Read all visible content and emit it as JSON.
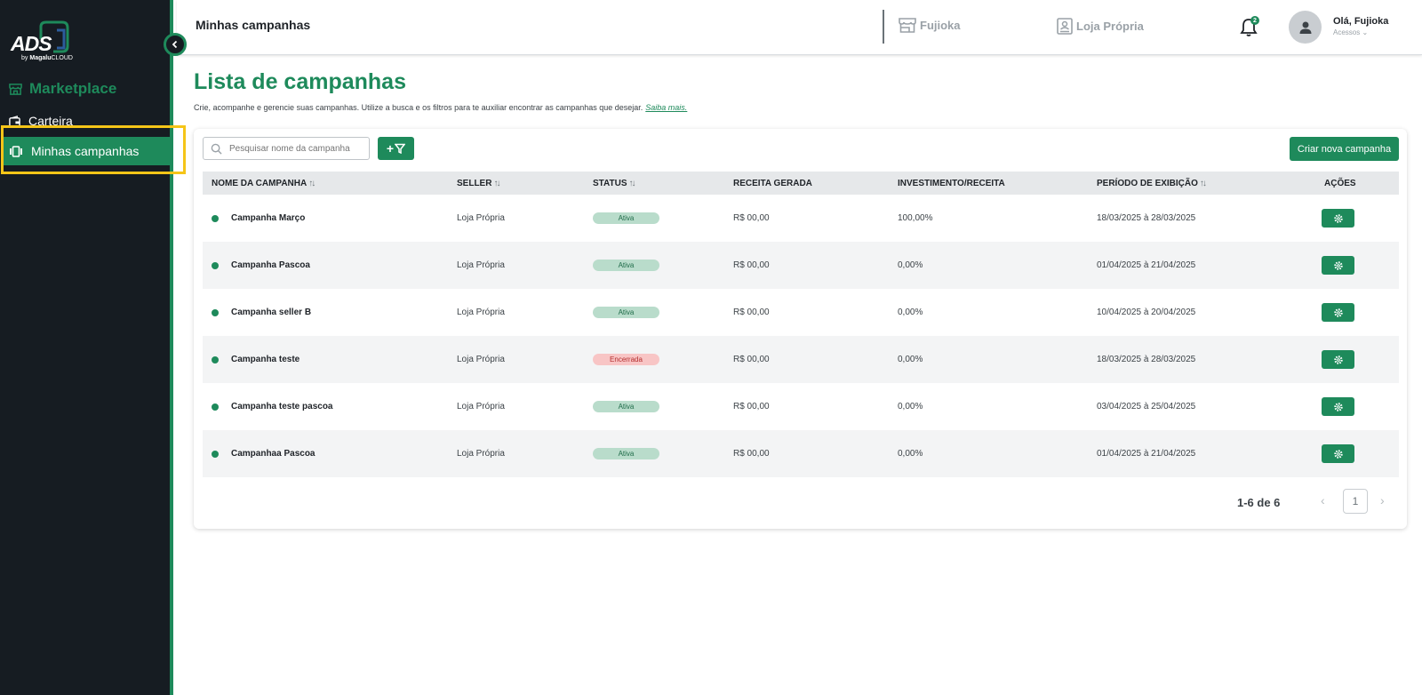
{
  "sidebar": {
    "logo": {
      "text": "ADS",
      "by": "by",
      "brand": "Magalu",
      "brand_suffix": "CLOUD"
    },
    "section_label": "Marketplace",
    "items": [
      {
        "label": "Carteira",
        "icon": "wallet-icon",
        "active": false
      },
      {
        "label": "Minhas campanhas",
        "icon": "campaigns-icon",
        "active": true
      }
    ]
  },
  "header": {
    "title": "Minhas campanhas",
    "stores": [
      {
        "label": "Fujioka",
        "icon": "store-icon"
      },
      {
        "label": "Loja Própria",
        "icon": "store-id-icon"
      }
    ],
    "notifications": {
      "count": "2"
    },
    "user": {
      "greeting": "Olá, Fujioka",
      "access_label": "Acessos"
    }
  },
  "page": {
    "title": "Lista de campanhas",
    "description": "Crie, acompanhe e gerencie suas campanhas. Utilize a busca e os filtros para te auxiliar encontrar as campanhas que desejar.",
    "learn_more": "Saiba mais."
  },
  "toolbar": {
    "search_placeholder": "Pesquisar nome da campanha",
    "filter_label": "+",
    "create_label": "Criar nova campanha"
  },
  "table": {
    "columns": [
      {
        "label": "NOME DA CAMPANHA",
        "sortable": true
      },
      {
        "label": "SELLER",
        "sortable": true
      },
      {
        "label": "STATUS",
        "sortable": true
      },
      {
        "label": "RECEITA GERADA",
        "sortable": false
      },
      {
        "label": "INVESTIMENTO/RECEITA",
        "sortable": false
      },
      {
        "label": "PERÍODO DE EXIBIÇÃO",
        "sortable": true
      },
      {
        "label": "AÇÕES",
        "sortable": false
      }
    ],
    "rows": [
      {
        "name": "Campanha Março",
        "seller": "Loja Própria",
        "status": "Ativa",
        "revenue": "R$ 00,00",
        "ratio": "100,00%",
        "period": "18/03/2025 à 28/03/2025"
      },
      {
        "name": "Campanha Pascoa",
        "seller": "Loja Própria",
        "status": "Ativa",
        "revenue": "R$ 00,00",
        "ratio": "0,00%",
        "period": "01/04/2025 à 21/04/2025"
      },
      {
        "name": "Campanha seller B",
        "seller": "Loja Própria",
        "status": "Ativa",
        "revenue": "R$ 00,00",
        "ratio": "0,00%",
        "period": "10/04/2025 à 20/04/2025"
      },
      {
        "name": "Campanha teste",
        "seller": "Loja Própria",
        "status": "Encerrada",
        "revenue": "R$ 00,00",
        "ratio": "0,00%",
        "period": "18/03/2025 à 28/03/2025"
      },
      {
        "name": "Campanha teste pascoa",
        "seller": "Loja Própria",
        "status": "Ativa",
        "revenue": "R$ 00,00",
        "ratio": "0,00%",
        "period": "03/04/2025 à 25/04/2025"
      },
      {
        "name": "Campanhaa Pascoa",
        "seller": "Loja Própria",
        "status": "Ativa",
        "revenue": "R$ 00,00",
        "ratio": "0,00%",
        "period": "01/04/2025 à 21/04/2025"
      }
    ]
  },
  "pagination": {
    "label": "1-6 de 6",
    "current_page": "1"
  },
  "colors": {
    "brand": "#1e8a5b",
    "sidebar_bg": "#161c22",
    "highlight": "#f5c518",
    "active_badge": "#b9dccb",
    "closed_badge": "#f8c5c5"
  }
}
